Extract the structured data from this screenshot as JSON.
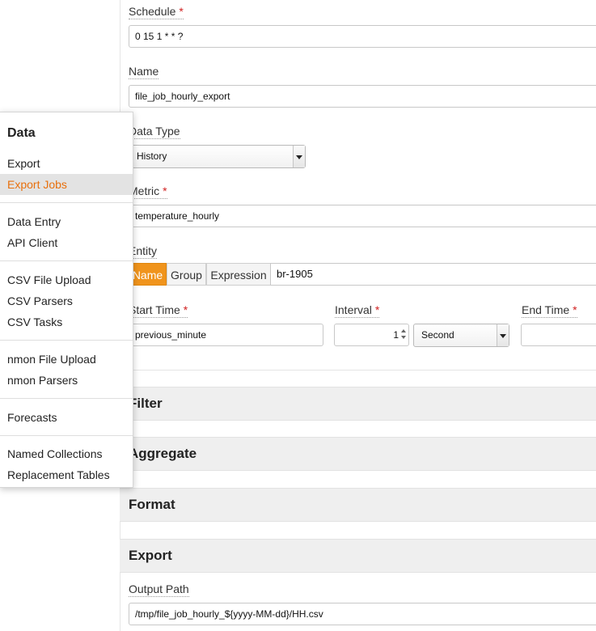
{
  "form": {
    "schedule": {
      "label": "Schedule",
      "value": "0 15 1 * * ?"
    },
    "name": {
      "label": "Name",
      "value": "file_job_hourly_export"
    },
    "data_type": {
      "label": "Data Type",
      "value": "History"
    },
    "metric": {
      "label": "Metric",
      "value": "temperature_hourly"
    },
    "entity": {
      "label": "Entity",
      "tabs": [
        "Name",
        "Group",
        "Expression"
      ],
      "value": "br-1905"
    },
    "start_time": {
      "label": "Start Time",
      "value": "previous_minute"
    },
    "interval": {
      "label": "Interval",
      "count": "1",
      "unit": "Second"
    },
    "end_time": {
      "label": "End Time",
      "value": ""
    },
    "required_mark": "*"
  },
  "sections": {
    "filter": "Filter",
    "aggregate": "Aggregate",
    "format": "Format",
    "export": "Export"
  },
  "export": {
    "output_path": {
      "label": "Output Path",
      "value": "/tmp/file_job_hourly_${yyyy-MM-dd}/HH.csv"
    }
  },
  "menu": {
    "heading": "Data",
    "items": [
      "Export",
      "Export Jobs",
      "Data Entry",
      "API Client",
      "CSV File Upload",
      "CSV Parsers",
      "CSV Tasks",
      "nmon File Upload",
      "nmon Parsers",
      "Forecasts",
      "Named Collections",
      "Replacement Tables"
    ],
    "active": "Export Jobs"
  },
  "colors": {
    "accent": "#f0941c",
    "menu_active_text": "#e8700d",
    "required": "#d01f1f"
  }
}
